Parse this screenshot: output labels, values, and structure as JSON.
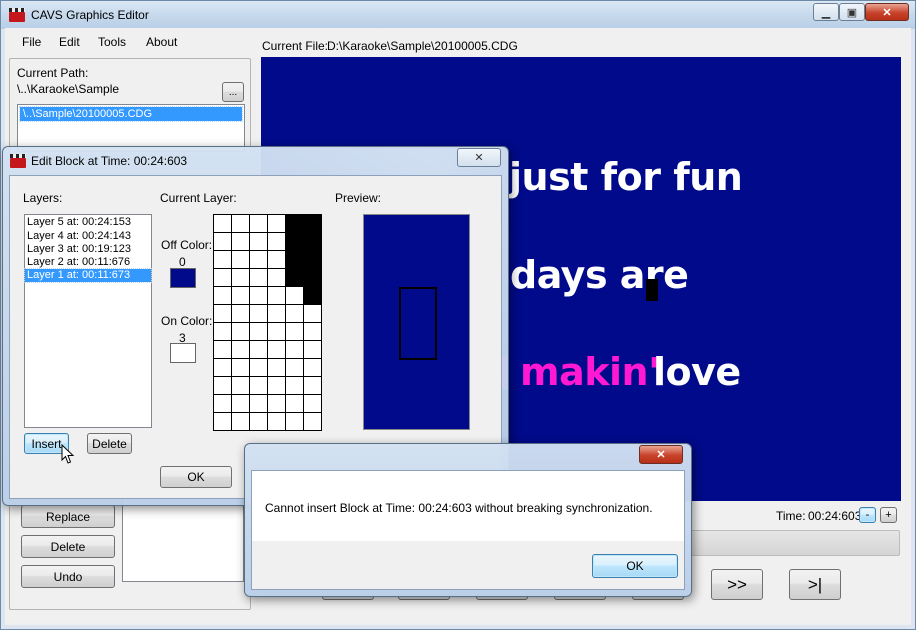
{
  "main": {
    "title": "CAVS Graphics Editor",
    "menu": [
      "File",
      "Edit",
      "Tools",
      "About"
    ],
    "current_path_label": "Current Path:",
    "current_path_value": "\\..\\Karaoke\\Sample",
    "browse_label": "...",
    "file_list": [
      "\\..\\Sample\\20100005.CDG"
    ],
    "current_file_label": "Current File:",
    "current_file_value": "D:\\Karaoke\\Sample\\20100005.CDG",
    "lyrics": [
      {
        "text": "just for fun",
        "color": "#ffffff"
      },
      {
        "text": "days are",
        "color": "#ffffff"
      },
      {
        "text": "makin'",
        "color": "#ff19d2"
      },
      {
        "text": "love",
        "color": "#ffffff"
      }
    ],
    "time_label": "Time:",
    "time_value": "00:24:603",
    "time_minus": "-",
    "time_plus": "+",
    "side_buttons": [
      "Replace",
      "Delete",
      "Undo"
    ],
    "nav_buttons": [
      ">>",
      ">|"
    ],
    "display_bg_color": "#000a8a"
  },
  "edit_dialog": {
    "title": "Edit Block at Time: 00:24:603",
    "layers_label": "Layers:",
    "layers": [
      "Layer 5 at: 00:24:153",
      "Layer 4 at: 00:24:143",
      "Layer 3 at: 00:19:123",
      "Layer 2 at: 00:11:676",
      "Layer 1 at: 00:11:673"
    ],
    "selected_layer_index": 4,
    "current_layer_label": "Current Layer:",
    "off_color_label": "Off Color:",
    "off_color_value": "0",
    "off_color_swatch": "#000a8a",
    "on_color_label": "On Color:",
    "on_color_value": "3",
    "on_color_swatch": "#ffffff",
    "preview_label": "Preview:",
    "insert_label": "Insert",
    "delete_label": "Delete",
    "ok_label": "OK",
    "close_glyph": "✕"
  },
  "message_box": {
    "message": "Cannot insert Block at Time: 00:24:603 without breaking synchronization.",
    "ok_label": "OK",
    "close_glyph": "✕"
  }
}
